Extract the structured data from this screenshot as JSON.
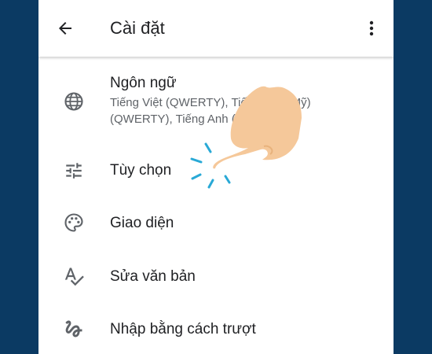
{
  "header": {
    "title": "Cài đặt",
    "back_icon": "arrow-back-icon",
    "menu_icon": "more-vert-icon"
  },
  "settings": {
    "items": [
      {
        "label": "Ngôn ngữ",
        "summary": "Tiếng Việt (QWERTY), Tiếng Anh (Mỹ) (QWERTY), Tiếng Anh (BC)",
        "icon": "globe-icon"
      },
      {
        "label": "Tùy chọn",
        "icon": "tune-icon"
      },
      {
        "label": "Giao diện",
        "icon": "palette-icon"
      },
      {
        "label": "Sửa văn bản",
        "icon": "spellcheck-icon"
      },
      {
        "label": "Nhập bằng cách trượt",
        "icon": "gesture-icon"
      }
    ]
  },
  "colors": {
    "background": "#0b3a63",
    "surface": "#ffffff",
    "text_primary": "#202124",
    "text_secondary": "#5f6368",
    "tap_indicator": "#29a9d6",
    "hand": "#f5c89a"
  }
}
